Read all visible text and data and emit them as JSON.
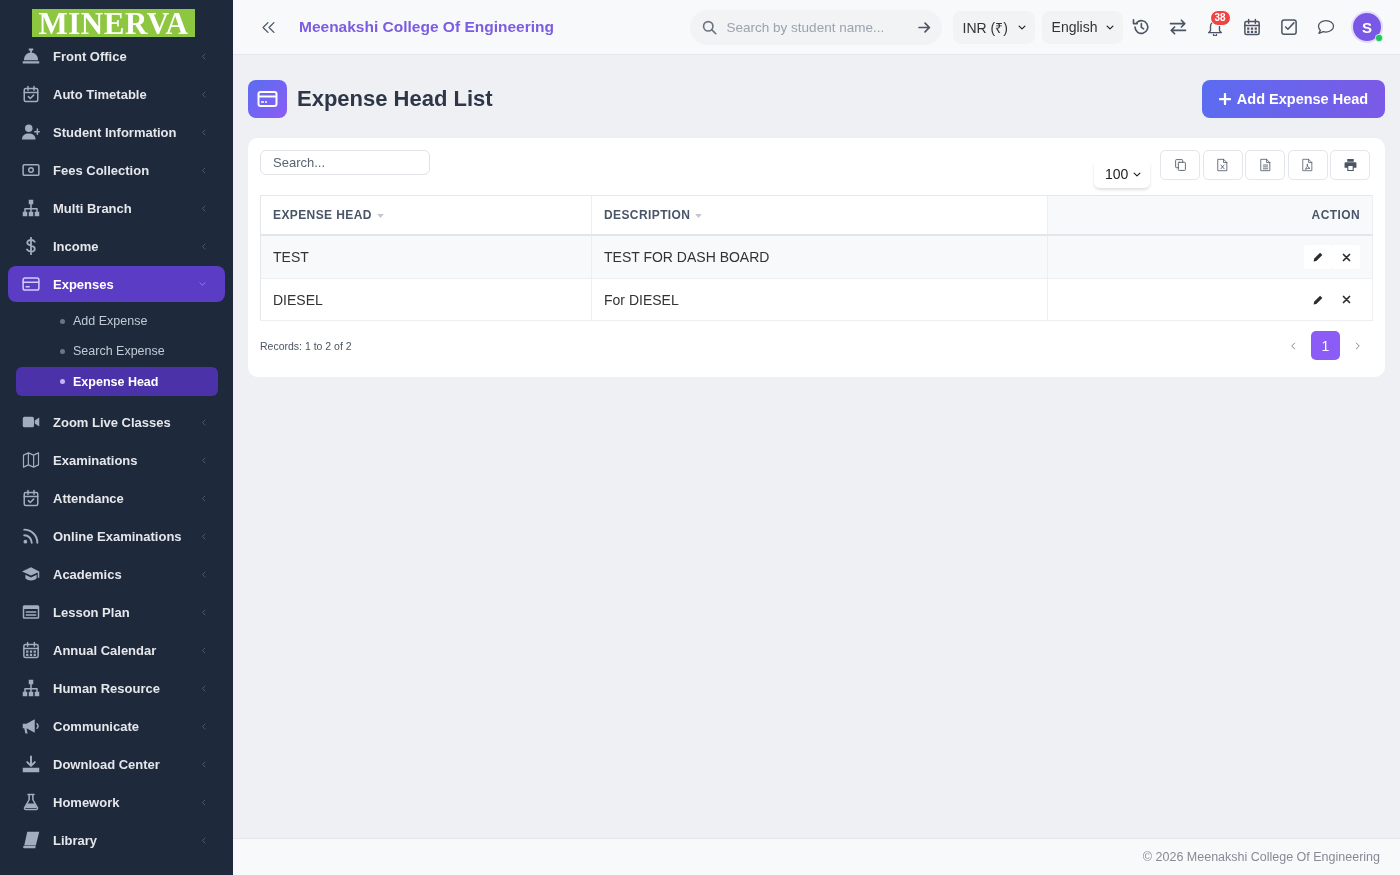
{
  "sidebar": {
    "logo": "MINERVA",
    "items": [
      {
        "label": "Front Office",
        "selected": false,
        "expanded": false
      },
      {
        "label": "Auto Timetable",
        "selected": false,
        "expanded": false
      },
      {
        "label": "Student Information",
        "selected": false,
        "expanded": false
      },
      {
        "label": "Fees Collection",
        "selected": false,
        "expanded": false
      },
      {
        "label": "Multi Branch",
        "selected": false,
        "expanded": false
      },
      {
        "label": "Income",
        "selected": false,
        "expanded": false
      },
      {
        "label": "Expenses",
        "selected": true,
        "expanded": true,
        "children": [
          {
            "label": "Add Expense",
            "selected": false
          },
          {
            "label": "Search Expense",
            "selected": false
          },
          {
            "label": "Expense Head",
            "selected": true
          }
        ]
      },
      {
        "label": "Zoom Live Classes",
        "selected": false,
        "expanded": false
      },
      {
        "label": "Examinations",
        "selected": false,
        "expanded": false
      },
      {
        "label": "Attendance",
        "selected": false,
        "expanded": false
      },
      {
        "label": "Online Examinations",
        "selected": false,
        "expanded": false
      },
      {
        "label": "Academics",
        "selected": false,
        "expanded": false
      },
      {
        "label": "Lesson Plan",
        "selected": false,
        "expanded": false
      },
      {
        "label": "Annual Calendar",
        "selected": false,
        "expanded": false
      },
      {
        "label": "Human Resource",
        "selected": false,
        "expanded": false
      },
      {
        "label": "Communicate",
        "selected": false,
        "expanded": false
      },
      {
        "label": "Download Center",
        "selected": false,
        "expanded": false
      },
      {
        "label": "Homework",
        "selected": false,
        "expanded": false
      },
      {
        "label": "Library",
        "selected": false,
        "expanded": false
      }
    ]
  },
  "header": {
    "title": "Meenakshi College Of Engineering",
    "search": {
      "placeholder": "Search by student name..."
    },
    "currency": "INR (₹)",
    "language": "English",
    "notification_count": "38",
    "avatar": {
      "initial": "S",
      "online": true
    }
  },
  "page": {
    "title": "Expense Head List",
    "add_button": "Add Expense Head"
  },
  "table": {
    "search": {
      "placeholder": "Search..."
    },
    "page_size": "100",
    "columns": [
      {
        "label": "EXPENSE HEAD",
        "kind": "data"
      },
      {
        "label": "DESCRIPTION",
        "kind": "data"
      },
      {
        "label": "ACTION",
        "kind": "action"
      }
    ],
    "rows": [
      {
        "cells": [
          "TEST",
          "TEST FOR DASH BOARD"
        ]
      },
      {
        "cells": [
          "DIESEL",
          "For DIESEL"
        ]
      }
    ],
    "records": "Records: 1 to 2 of 2",
    "pages": [
      {
        "label": "1",
        "selected": true
      }
    ]
  },
  "footer": {
    "text": "© 2026 Meenakshi College Of Engineering"
  }
}
